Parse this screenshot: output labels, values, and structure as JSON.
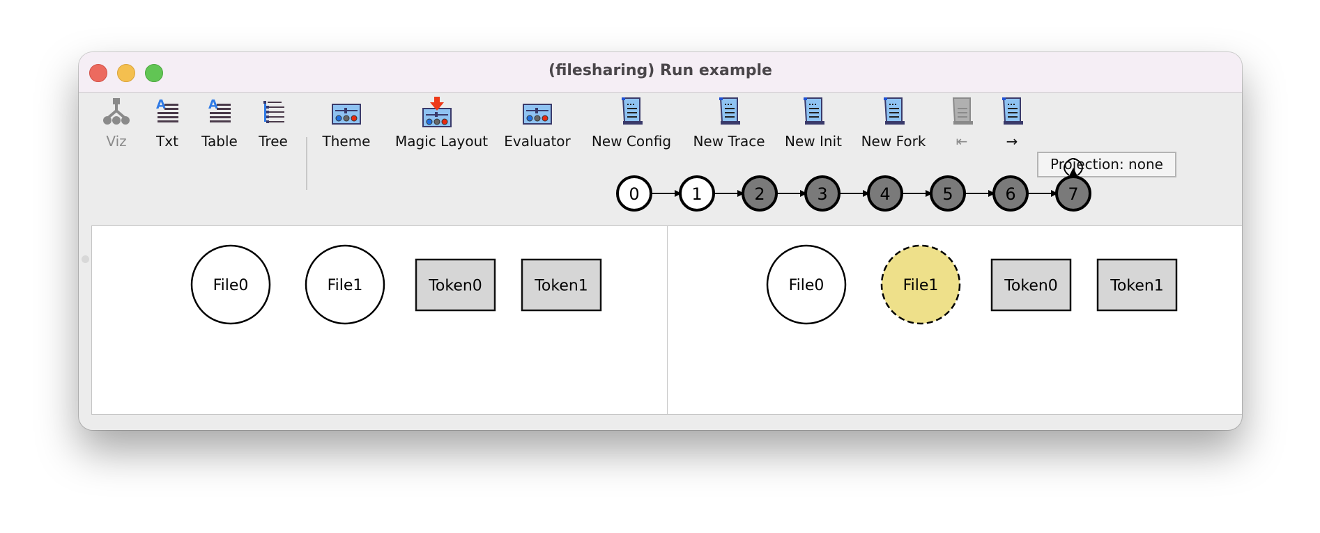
{
  "window": {
    "title": "(filesharing) Run example",
    "controls": [
      "close",
      "minimize",
      "zoom"
    ]
  },
  "toolbar": {
    "items": [
      {
        "label": "Viz",
        "icon": "graph-tree-icon",
        "enabled": false
      },
      {
        "label": "Txt",
        "icon": "text-lines-icon",
        "enabled": true
      },
      {
        "label": "Table",
        "icon": "table-lines-icon",
        "enabled": true
      },
      {
        "label": "Tree",
        "icon": "tree-list-icon",
        "enabled": true
      },
      {
        "label": "Theme",
        "icon": "theme-sliders-icon",
        "enabled": true
      },
      {
        "label": "Magic Layout",
        "icon": "magic-layout-icon",
        "enabled": true
      },
      {
        "label": "Evaluator",
        "icon": "evaluator-sliders-icon",
        "enabled": true
      },
      {
        "label": "New Config",
        "icon": "scroll-icon",
        "enabled": true
      },
      {
        "label": "New Trace",
        "icon": "scroll-icon",
        "enabled": true
      },
      {
        "label": "New Init",
        "icon": "scroll-icon",
        "enabled": true
      },
      {
        "label": "New Fork",
        "icon": "scroll-icon",
        "enabled": true
      },
      {
        "label": "⇤",
        "icon": "scroll-icon",
        "enabled": false
      },
      {
        "label": "→",
        "icon": "scroll-icon",
        "enabled": true
      }
    ],
    "projection_label": "Projection: none"
  },
  "state_graph": {
    "states": [
      {
        "label": "0",
        "visited": true
      },
      {
        "label": "1",
        "visited": true
      },
      {
        "label": "2",
        "visited": false
      },
      {
        "label": "3",
        "visited": false
      },
      {
        "label": "4",
        "visited": false
      },
      {
        "label": "5",
        "visited": false
      },
      {
        "label": "6",
        "visited": false
      },
      {
        "label": "7",
        "visited": false
      }
    ],
    "self_loop_on": "7",
    "colors": {
      "visited": "#ffffff",
      "unvisited": "#7a7a7a",
      "stroke": "#000000"
    }
  },
  "panels": [
    {
      "name": "left",
      "atoms": [
        {
          "label": "File0",
          "shape": "circle",
          "fill": "#ffffff",
          "dashed": false
        },
        {
          "label": "File1",
          "shape": "circle",
          "fill": "#ffffff",
          "dashed": false
        },
        {
          "label": "Token0",
          "shape": "box",
          "fill": "#d6d6d6",
          "dashed": false
        },
        {
          "label": "Token1",
          "shape": "box",
          "fill": "#d6d6d6",
          "dashed": false
        }
      ]
    },
    {
      "name": "right",
      "atoms": [
        {
          "label": "File0",
          "shape": "circle",
          "fill": "#ffffff",
          "dashed": false
        },
        {
          "label": "File1",
          "shape": "circle",
          "fill": "#eee08a",
          "dashed": true
        },
        {
          "label": "Token0",
          "shape": "box",
          "fill": "#d6d6d6",
          "dashed": false
        },
        {
          "label": "Token1",
          "shape": "box",
          "fill": "#d6d6d6",
          "dashed": false
        }
      ]
    }
  ]
}
